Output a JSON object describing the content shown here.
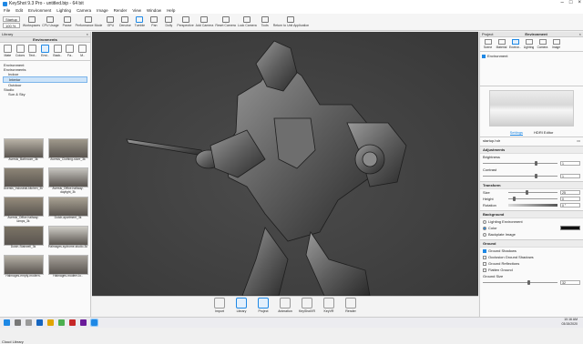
{
  "window": {
    "title": "KeyShot 9.3 Pro - untitled.bip - 64 bit"
  },
  "menu": [
    "File",
    "Edit",
    "Environment",
    "Lighting",
    "Camera",
    "Image",
    "Render",
    "View",
    "Window",
    "Help"
  ],
  "toolbar": {
    "workspace_select": "Startup",
    "zoom_select": "100 %",
    "buttons": [
      {
        "label": "Workspaces",
        "icon": "workspace-icon"
      },
      {
        "label": "CPU Usage",
        "icon": "cpu-icon"
      },
      {
        "label": "Pause",
        "icon": "pause-icon"
      },
      {
        "label": "Performance Mode",
        "icon": "performance-icon"
      },
      {
        "label": "GPU",
        "icon": "gpu-icon"
      },
      {
        "label": "Denoise",
        "icon": "denoise-icon"
      },
      {
        "label": "Tumble",
        "icon": "tumble-icon",
        "active": true
      },
      {
        "label": "Pan",
        "icon": "pan-icon"
      },
      {
        "label": "Dolly",
        "icon": "dolly-icon"
      },
      {
        "label": "Perspective",
        "icon": "perspective-icon"
      },
      {
        "label": "Add Camera",
        "icon": "camera-icon"
      },
      {
        "label": "Reset Camera",
        "icon": "reset-camera-icon"
      },
      {
        "label": "Lock Camera",
        "icon": "lock-icon"
      },
      {
        "label": "Tools",
        "icon": "tools-icon"
      },
      {
        "label": "Return to Unit Application",
        "icon": "return-icon"
      }
    ]
  },
  "library": {
    "panel_title": "Library",
    "header": "Environments",
    "tabs": [
      {
        "label": "Mate",
        "icon": "material-icon"
      },
      {
        "label": "Colors",
        "icon": "colors-icon"
      },
      {
        "label": "Text..",
        "icon": "textures-icon"
      },
      {
        "label": "Envi..",
        "icon": "environment-icon",
        "active": true
      },
      {
        "label": "Back..",
        "icon": "backplates-icon"
      },
      {
        "label": "Fa..",
        "icon": "favorites-icon"
      },
      {
        "label": "M..",
        "icon": "models-icon"
      }
    ],
    "tree": [
      {
        "label": "Environment",
        "indent": 0
      },
      {
        "label": "Environments",
        "indent": 0
      },
      {
        "label": "Indoor",
        "indent": 1
      },
      {
        "label": "Interior",
        "indent": 1,
        "selected": true
      },
      {
        "label": "Outdoor",
        "indent": 1
      },
      {
        "label": "Studio",
        "indent": 0
      },
      {
        "label": "Sun & Sky",
        "indent": 1
      }
    ],
    "thumbnails": [
      {
        "caption": "Aversis_Bathroom_3k",
        "tone": "#b9b3a7"
      },
      {
        "caption": "Aversis_Clothing-store_3k",
        "tone": "#a09a8c"
      },
      {
        "caption": "Aversis_Industrial-kitchen_3k",
        "tone": "#8d8577"
      },
      {
        "caption": "Aversis_Office-hallway-daylight_3k",
        "tone": "#c6c4bf"
      },
      {
        "caption": "Aversis_Office-hallway-lamps_3k",
        "tone": "#958c7c"
      },
      {
        "caption": "Dutch-apartment_3k",
        "tone": "#a9a293"
      },
      {
        "caption": "Dutch-Stairwell_3k",
        "tone": "#7c7466"
      },
      {
        "caption": "Halmages-sydrome-studio-3k",
        "tone": "#cfcdc7"
      },
      {
        "caption": "Halmages-empty-modern-",
        "tone": "#b7b2a8"
      },
      {
        "caption": "Halmages-modern-lo..",
        "tone": "#a6a19a"
      }
    ],
    "cloud_label": "Cloud Library"
  },
  "bottombar": [
    {
      "label": "Import",
      "icon": "import-icon"
    },
    {
      "label": "Library",
      "icon": "library-icon",
      "active": true
    },
    {
      "label": "Project",
      "icon": "project-icon",
      "active": true
    },
    {
      "label": "Animation",
      "icon": "animation-icon"
    },
    {
      "label": "KeyShotXR",
      "icon": "keyshotxr-icon"
    },
    {
      "label": "KeyVR",
      "icon": "keyvr-icon"
    },
    {
      "label": "Render",
      "icon": "render-icon"
    }
  ],
  "project": {
    "panel_title": "Project",
    "header": "Environment",
    "tabs": [
      {
        "label": "Scene",
        "icon": "scene-icon"
      },
      {
        "label": "Material",
        "icon": "material-tab-icon"
      },
      {
        "label": "Environ..",
        "icon": "environment-tab-icon",
        "active": true
      },
      {
        "label": "Lighting",
        "icon": "lighting-icon"
      },
      {
        "label": "Camera",
        "icon": "camera-tab-icon"
      },
      {
        "label": "Image",
        "icon": "image-icon"
      }
    ],
    "env_item": "Environment",
    "subtabs": [
      "Settings",
      "HDRI Editor"
    ],
    "hdri_name": "startup.hdr",
    "adjustments": {
      "title": "Adjustments",
      "brightness_label": "Brightness",
      "brightness": "1",
      "contrast_label": "Contrast",
      "contrast": "1"
    },
    "transform": {
      "title": "Transform",
      "size_label": "Size",
      "size": "25",
      "height_label": "Height",
      "height": "0",
      "rotation_label": "Rotation",
      "rotation": "0 °"
    },
    "background": {
      "title": "Background",
      "options": [
        {
          "label": "Lighting Environment",
          "on": false
        },
        {
          "label": "Color",
          "on": true
        },
        {
          "label": "Backplate Image",
          "on": false
        }
      ],
      "color": "#111111"
    },
    "ground": {
      "title": "Ground",
      "options": [
        {
          "label": "Ground Shadows",
          "on": true
        },
        {
          "label": "Occlusion Ground Shadows",
          "on": false
        },
        {
          "label": "Ground Reflections",
          "on": false
        },
        {
          "label": "Flatten Ground",
          "on": false
        }
      ],
      "size_label": "Ground Size",
      "size": "32"
    }
  },
  "taskbar": {
    "time": "10:16 AM",
    "date": "03/15/2020"
  }
}
